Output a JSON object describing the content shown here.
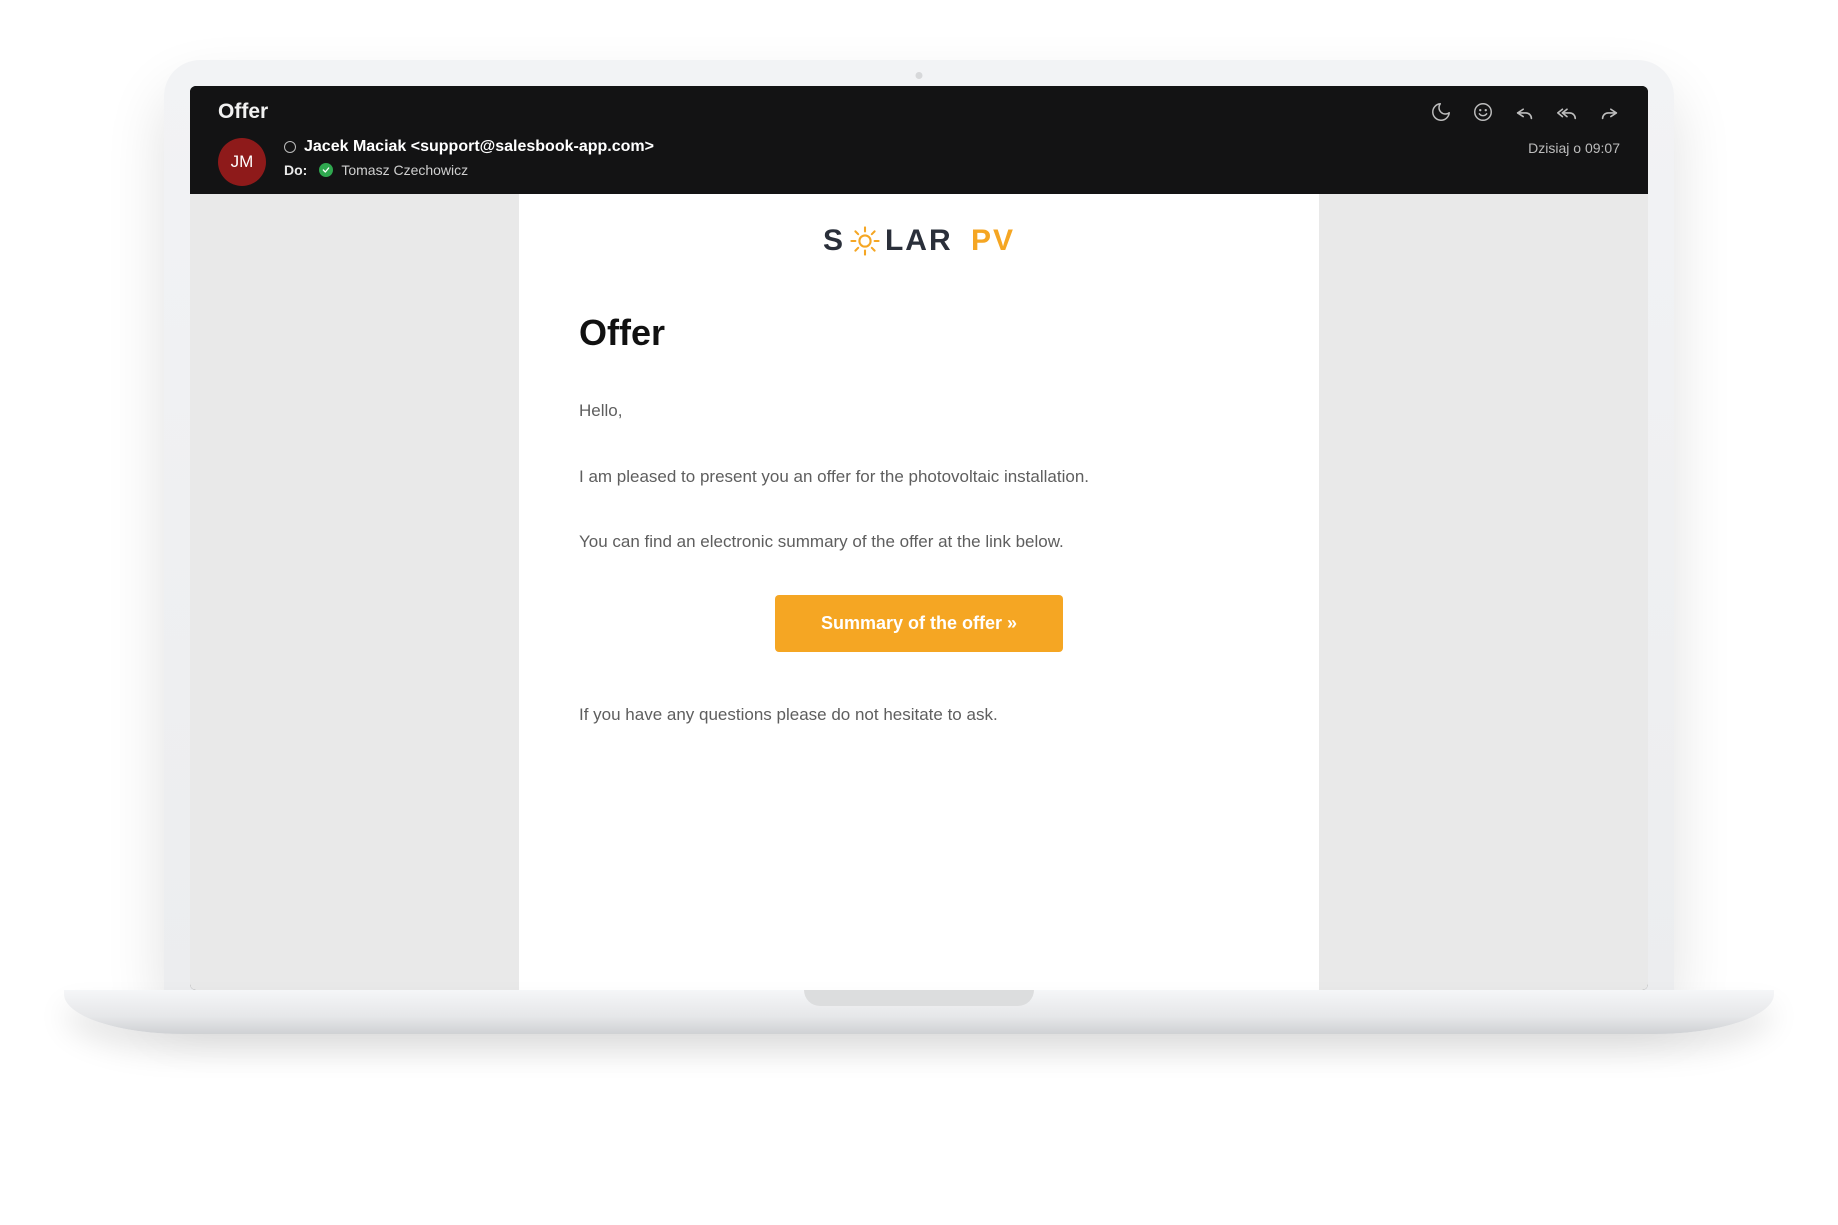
{
  "header": {
    "subject": "Offer",
    "timestamp": "Dzisiaj o 09:07",
    "avatar_initials": "JM",
    "from": "Jacek Maciak <support@salesbook-app.com>",
    "to_label": "Do:",
    "to_name": "Tomasz Czechowicz"
  },
  "body": {
    "brand": {
      "s": "S",
      "lar": "LAR",
      "pv": "PV"
    },
    "title": "Offer",
    "greeting": "Hello,",
    "line1": "I am pleased to present you an offer for the photovoltaic installation.",
    "line2": "You can find an electronic summary of the offer at the link below.",
    "cta_label": "Summary of the offer »",
    "line3": "If you have any questions please do not hesitate to ask."
  }
}
